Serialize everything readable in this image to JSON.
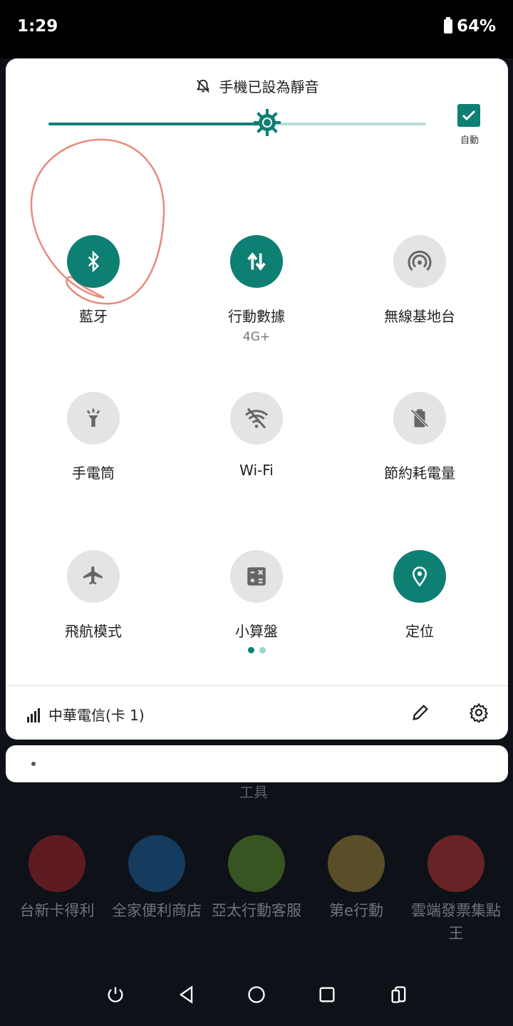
{
  "status_bar": {
    "time": "1:29",
    "battery": "64%"
  },
  "quick_settings": {
    "silent_message": "手機已設為靜音",
    "brightness_level": 0.58,
    "auto_brightness_label": "自動",
    "tiles": [
      {
        "label": "藍牙",
        "sub": "",
        "icon": "bluetooth-icon",
        "state": "on"
      },
      {
        "label": "行動數據",
        "sub": "4G+",
        "icon": "mobile-data-icon",
        "state": "on"
      },
      {
        "label": "無線基地台",
        "sub": "",
        "icon": "hotspot-icon",
        "state": "off"
      },
      {
        "label": "手電筒",
        "sub": "",
        "icon": "flashlight-icon",
        "state": "off"
      },
      {
        "label": "Wi-Fi",
        "sub": "",
        "icon": "wifi-off-icon",
        "state": "off"
      },
      {
        "label": "節約耗電量",
        "sub": "",
        "icon": "battery-saver-icon",
        "state": "off"
      },
      {
        "label": "飛航模式",
        "sub": "",
        "icon": "airplane-icon",
        "state": "off"
      },
      {
        "label": "小算盤",
        "sub": "",
        "icon": "calculator-icon",
        "state": "off"
      },
      {
        "label": "定位",
        "sub": "",
        "icon": "location-icon",
        "state": "on"
      }
    ],
    "page_indicator": {
      "current": 1,
      "total": 2
    },
    "carrier": "中華電信(卡 1)"
  },
  "home": {
    "folder_label": "工具",
    "apps": [
      {
        "label": "台新卡得利",
        "color": "#c0272d"
      },
      {
        "label": "全家便利商店",
        "color": "#1f6fb5"
      },
      {
        "label": "亞太行動客服",
        "color": "#6aa82e"
      },
      {
        "label": "第e行動",
        "color": "#b99a3c"
      },
      {
        "label": "雲端發票集點王",
        "color": "#d63a3a"
      }
    ]
  },
  "colors": {
    "accent": "#0e7f73",
    "tile_off": "#e4e4e4",
    "accent_light": "#b8dcd7"
  }
}
